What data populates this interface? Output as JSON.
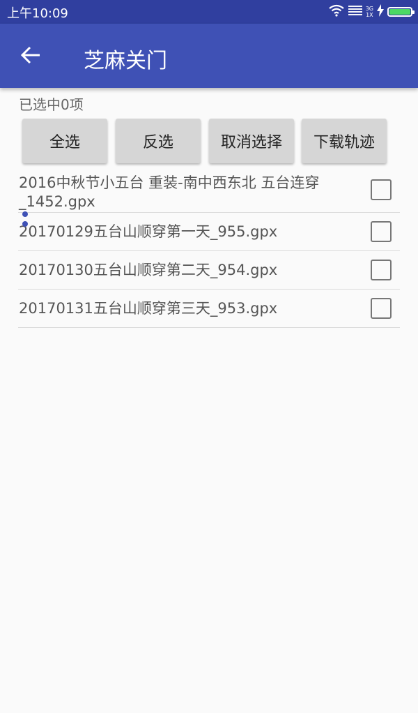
{
  "status_bar": {
    "time": "上午10:09",
    "network_type": "3G",
    "network_sub": "1X",
    "icons": [
      "wifi-icon",
      "signal-icon",
      "charging-icon",
      "battery-icon"
    ],
    "battery_color": "#4cd964"
  },
  "app_bar": {
    "title": "芝麻关门",
    "back_icon": "arrow-left-icon",
    "color": "#3f51b5"
  },
  "selection": {
    "count_text": "已选中0项"
  },
  "actions": {
    "select_all": "全选",
    "invert_selection": "反选",
    "cancel_selection": "取消选择",
    "download_tracks": "下载轨迹"
  },
  "files": [
    {
      "name_line1": "2016中秋节小五台  重装-南中西东北 五台连穿",
      "name_line2": "_1452.gpx",
      "checked": false
    },
    {
      "name": "20170129五台山顺穿第一天_955.gpx",
      "checked": false
    },
    {
      "name": "20170130五台山顺穿第二天_954.gpx",
      "checked": false
    },
    {
      "name": "20170131五台山顺穿第三天_953.gpx",
      "checked": false
    }
  ]
}
